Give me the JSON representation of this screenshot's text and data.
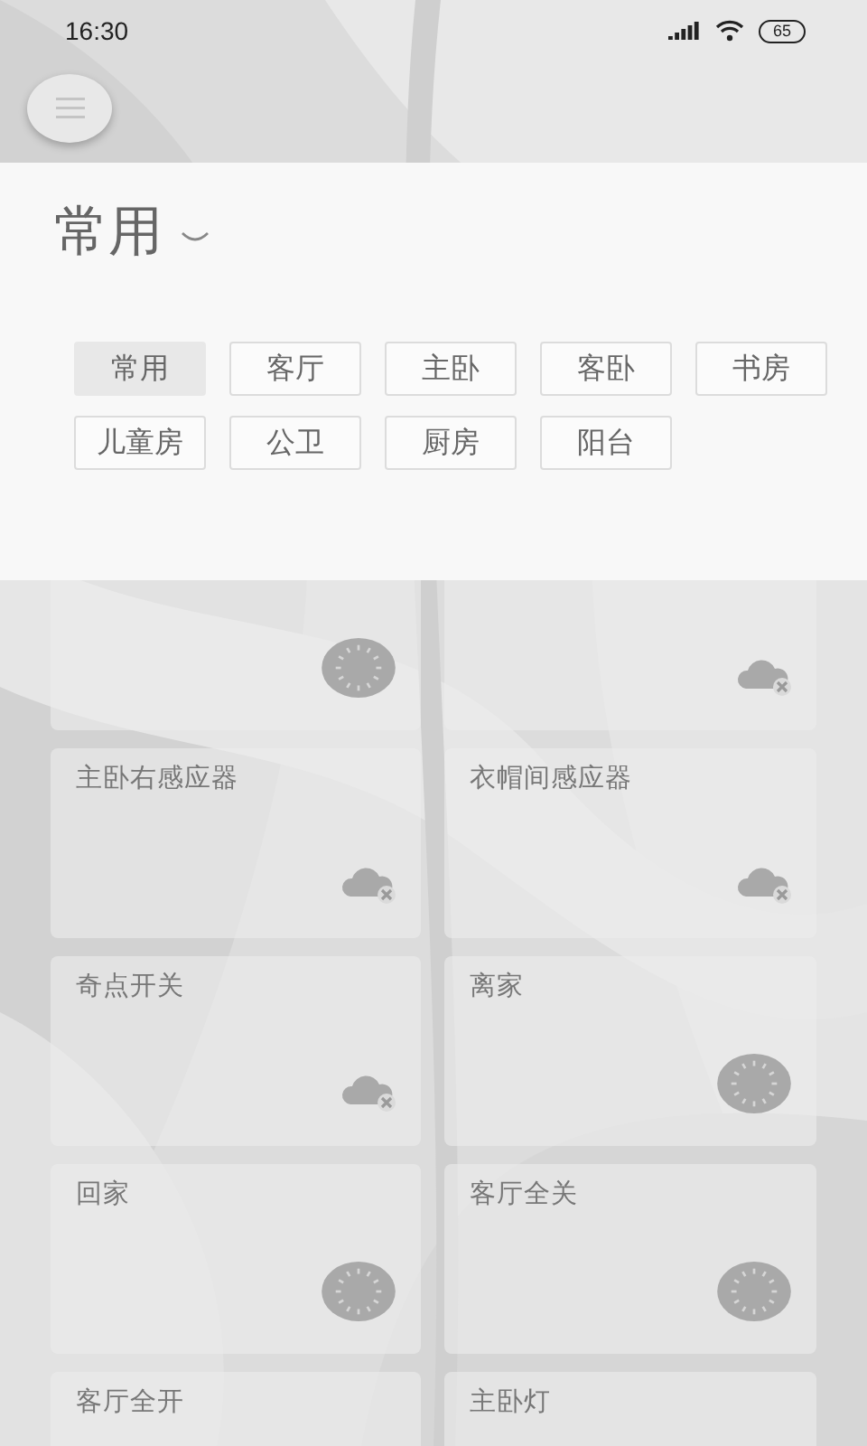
{
  "status_bar": {
    "time": "16:30",
    "battery": "65"
  },
  "header": {
    "title": "常用"
  },
  "rooms": [
    {
      "label": "常用",
      "selected": true
    },
    {
      "label": "客厅",
      "selected": false
    },
    {
      "label": "主卧",
      "selected": false
    },
    {
      "label": "客卧",
      "selected": false
    },
    {
      "label": "书房",
      "selected": false
    },
    {
      "label": "儿童房",
      "selected": false
    },
    {
      "label": "公卫",
      "selected": false
    },
    {
      "label": "厨房",
      "selected": false
    },
    {
      "label": "阳台",
      "selected": false
    }
  ],
  "devices": [
    {
      "kind": "scene"
    },
    {
      "kind": "offline"
    },
    {
      "title": "主卧右感应器",
      "kind": "offline"
    },
    {
      "title": "衣帽间感应器",
      "kind": "offline"
    },
    {
      "title": "奇点开关",
      "kind": "offline"
    },
    {
      "title": "离家",
      "kind": "scene"
    },
    {
      "title": "回家",
      "kind": "scene"
    },
    {
      "title": "客厅全关",
      "kind": "scene"
    },
    {
      "title": "客厅全开"
    },
    {
      "title": "主卧灯"
    }
  ]
}
